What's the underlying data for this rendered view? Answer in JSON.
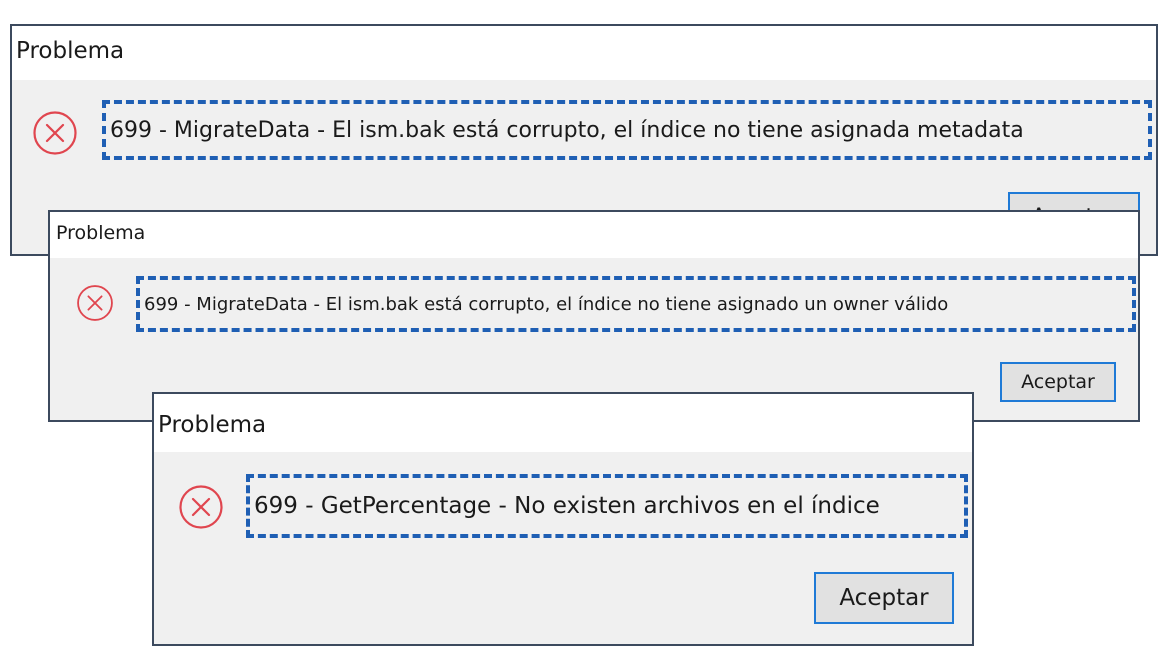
{
  "dialogs": [
    {
      "title": "Problema",
      "message": "699 - MigrateData - El ism.bak está corrupto, el índice no tiene asignada metadata",
      "button_label": "Aceptar"
    },
    {
      "title": "Problema",
      "message": "699 - MigrateData - El ism.bak está corrupto, el índice no tiene asignado un owner válido",
      "button_label": "Aceptar"
    },
    {
      "title": "Problema",
      "message": "699 - GetPercentage - No existen archivos en el índice",
      "button_label": "Aceptar"
    }
  ],
  "icons": {
    "error": "error-circle-x-icon"
  },
  "colors": {
    "error_icon": "#e0464f",
    "highlight_border": "#1f5fb4",
    "dialog_border": "#3c4a5e",
    "button_border": "#1f7ad6",
    "dialog_body": "#f0f0f0"
  }
}
